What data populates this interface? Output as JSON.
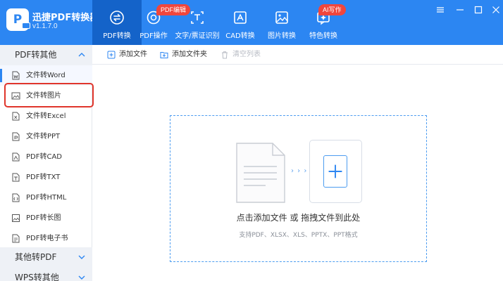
{
  "app": {
    "logo_char": "P",
    "name": "迅捷PDF转换器",
    "version": "v1.1.7.0"
  },
  "nav": {
    "tabs": [
      {
        "label": "PDF转换",
        "icon": "convert-icon",
        "active": true
      },
      {
        "label": "PDF操作",
        "icon": "pdf-operate-icon"
      },
      {
        "label": "文字/票证识别",
        "icon": "ocr-icon"
      },
      {
        "label": "CAD转换",
        "icon": "cad-icon"
      },
      {
        "label": "图片转换",
        "icon": "image-icon"
      },
      {
        "label": "特色转换",
        "icon": "ai-feature-icon"
      }
    ],
    "badge_pdf": "PDF编辑",
    "badge_ai": "AI写作"
  },
  "sidebar": {
    "group1": "PDF转其他",
    "items": [
      {
        "label": "文件转Word",
        "icon": "word-icon",
        "active": true
      },
      {
        "label": "文件转图片",
        "icon": "picture-icon"
      },
      {
        "label": "文件转Excel",
        "icon": "excel-icon"
      },
      {
        "label": "文件转PPT",
        "icon": "ppt-icon"
      },
      {
        "label": "PDF转CAD",
        "icon": "cad-file-icon"
      },
      {
        "label": "PDF转TXT",
        "icon": "txt-icon"
      },
      {
        "label": "PDF转HTML",
        "icon": "html-icon"
      },
      {
        "label": "PDF转长图",
        "icon": "long-image-icon"
      },
      {
        "label": "PDF转电子书",
        "icon": "ebook-icon"
      }
    ],
    "group2": "其他转PDF",
    "group3": "WPS转其他"
  },
  "toolbar": {
    "add_file": "添加文件",
    "add_folder": "添加文件夹",
    "clear_list": "清空列表"
  },
  "dropzone": {
    "arrows": "› › ›",
    "main_text": "点击添加文件 或 拖拽文件到此处",
    "sub_text": "支持PDF、XLSX、XLS、PPTX、PPT格式"
  },
  "colors": {
    "brand": "#2c86f2",
    "brand_dark": "#1463c9",
    "badge": "#f0463c",
    "highlight": "#e0352b"
  }
}
